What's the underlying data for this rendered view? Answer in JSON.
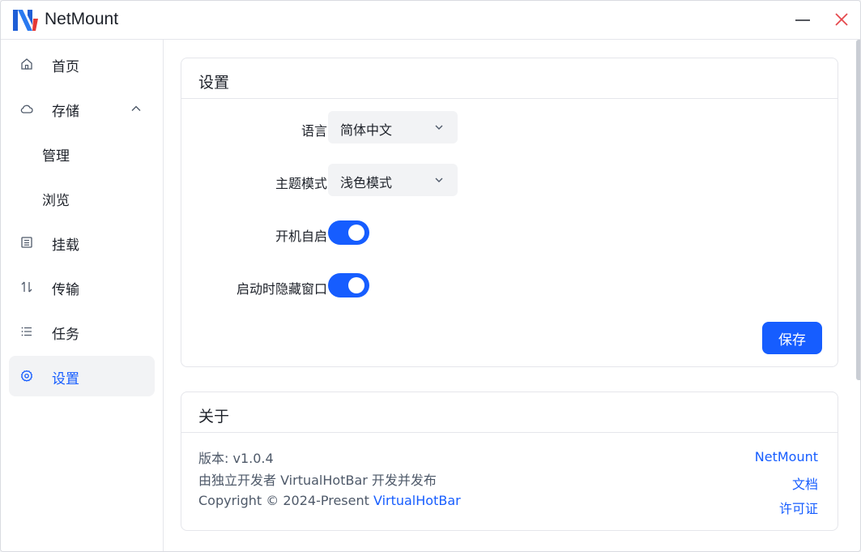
{
  "app": {
    "title": "NetMount",
    "accent": "#165dff",
    "close_color": "#e5484d"
  },
  "sidebar": {
    "items": [
      {
        "label": "首页",
        "icon": "home-icon"
      },
      {
        "label": "存储",
        "icon": "cloud-icon",
        "expanded": true
      },
      {
        "label": "管理"
      },
      {
        "label": "浏览"
      },
      {
        "label": "挂载",
        "icon": "mount-list-icon"
      },
      {
        "label": "传输",
        "icon": "transfer-arrows-icon"
      },
      {
        "label": "任务",
        "icon": "task-list-icon"
      },
      {
        "label": "设置",
        "icon": "gear-icon",
        "active": true
      }
    ]
  },
  "settings": {
    "title": "设置",
    "language_label": "语言",
    "language_value": "简体中文",
    "theme_label": "主题模式",
    "theme_value": "浅色模式",
    "autostart_label": "开机自启",
    "autostart_on": true,
    "hide_label": "启动时隐藏窗口",
    "hide_on": true,
    "save_label": "保存"
  },
  "about": {
    "title": "关于",
    "version": "版本: v1.0.4",
    "developer": "由独立开发者 VirtualHotBar 开发并发布",
    "copyright_prefix": "Copyright © 2024-Present ",
    "copyright_link": "VirtualHotBar",
    "links": [
      "NetMount",
      "文档",
      "许可证"
    ]
  }
}
